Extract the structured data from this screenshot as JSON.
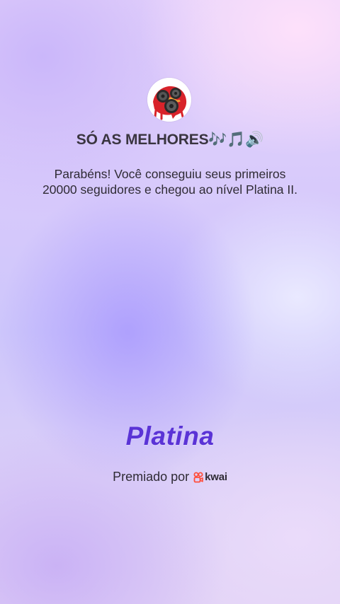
{
  "profile": {
    "name": "SÓ AS MELHORES🎶🎵🔊",
    "avatar_icon": "speakers-avatar-icon"
  },
  "message": "Parabéns! Você conseguiu seus primeiros 20000 seguidores e chegou ao nível Platina II.",
  "level": "Platina",
  "awarded": {
    "label": "Premiado por",
    "brand": "kwai",
    "brand_icon": "kwai-logo-icon",
    "brand_color": "#ff4d3a"
  },
  "colors": {
    "level_text": "#5a33d6"
  }
}
